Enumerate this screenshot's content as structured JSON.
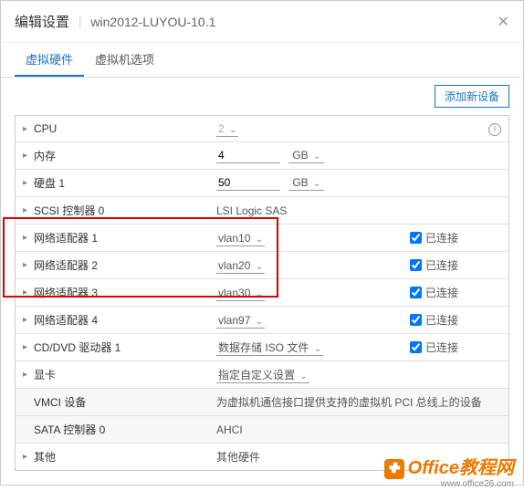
{
  "dialog": {
    "title": "编辑设置",
    "subtitle": "win2012-LUYOU-10.1"
  },
  "tabs": {
    "hardware": "虚拟硬件",
    "options": "虚拟机选项"
  },
  "toolbar": {
    "add_device": "添加新设备"
  },
  "rows": {
    "cpu": {
      "label": "CPU",
      "value": "2"
    },
    "memory": {
      "label": "内存",
      "value": "4",
      "unit": "GB"
    },
    "disk1": {
      "label": "硬盘 1",
      "value": "50",
      "unit": "GB"
    },
    "scsi0": {
      "label": "SCSI 控制器 0",
      "value": "LSI Logic SAS"
    },
    "net1": {
      "label": "网络适配器 1",
      "value": "vlan10",
      "connected": "已连接"
    },
    "net2": {
      "label": "网络适配器 2",
      "value": "vlan20",
      "connected": "已连接"
    },
    "net3": {
      "label": "网络适配器 3",
      "value": "vlan30",
      "connected": "已连接"
    },
    "net4": {
      "label": "网络适配器 4",
      "value": "vlan97",
      "connected": "已连接"
    },
    "cddvd": {
      "label": "CD/DVD 驱动器 1",
      "value": "数据存储 ISO 文件",
      "connected": "已连接"
    },
    "video": {
      "label": "显卡",
      "value": "指定自定义设置"
    },
    "vmci": {
      "label": "VMCI 设备",
      "value": "为虚拟机通信接口提供支持的虚拟机 PCI 总线上的设备"
    },
    "sata": {
      "label": "SATA 控制器 0",
      "value": "AHCI"
    },
    "other": {
      "label": "其他",
      "value": "其他硬件"
    }
  },
  "watermark": {
    "brand": "Office教程网",
    "url": "www.office26.com"
  }
}
